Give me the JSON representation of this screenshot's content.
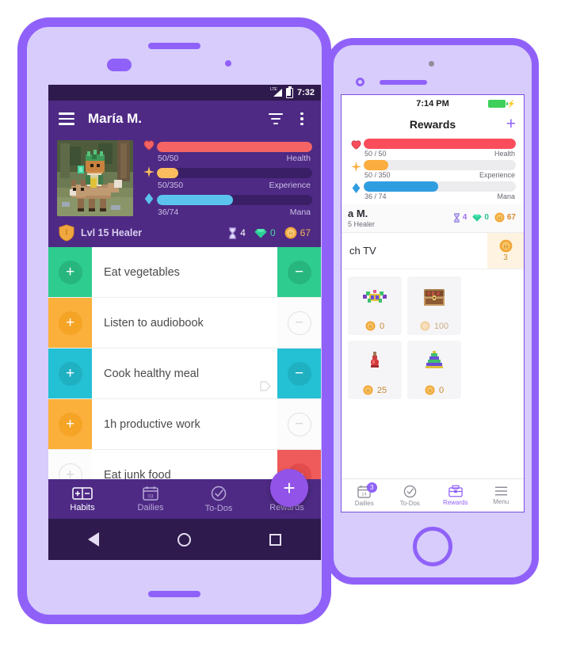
{
  "android": {
    "status_bar": {
      "time": "7:32",
      "signal_label": "LTE"
    },
    "appbar": {
      "title": "María M.",
      "menu_icon": "hamburger-icon",
      "filter_icon": "filter-icon",
      "overflow_icon": "overflow-menu-icon"
    },
    "stats": {
      "bars": [
        {
          "icon": "heart-icon",
          "value": "50/50",
          "label": "Health",
          "percent": 100,
          "color": "#f56465"
        },
        {
          "icon": "star-icon",
          "value": "50/350",
          "label": "Experience",
          "percent": 14,
          "color": "#fbbd5e"
        },
        {
          "icon": "diamond-icon",
          "value": "36/74",
          "label": "Mana",
          "percent": 49,
          "color": "#5cc3ef"
        }
      ],
      "level_text": "Lvl 15 Healer",
      "class_icon": "shield-icon",
      "hourglass_icon": "hourglass-icon",
      "hourglass_value": "4",
      "gem_icon": "gem-icon",
      "gem_value": "0",
      "gold_icon": "gold-coin-icon",
      "gold_value": "67"
    },
    "habits": [
      {
        "title": "Eat vegetables",
        "color": "#2ecc8f",
        "plus": true,
        "minus": true,
        "tag": false
      },
      {
        "title": "Listen to audiobook",
        "color": "#fbb03b",
        "plus": true,
        "minus": false,
        "tag": false
      },
      {
        "title": "Cook healthy meal",
        "color": "#24c0d4",
        "plus": true,
        "minus": true,
        "tag": true
      },
      {
        "title": "1h productive work",
        "color": "#fbb03b",
        "plus": true,
        "minus": false,
        "tag": false
      },
      {
        "title": "Eat junk food",
        "color": "#ef5a5a",
        "plus": false,
        "minus": true,
        "tag": false
      }
    ],
    "fab_label": "+",
    "bottom_nav": [
      {
        "label": "Habits",
        "icon": "habits-icon",
        "active": true
      },
      {
        "label": "Dailies",
        "icon": "calendar-icon",
        "active": false,
        "calendar_day": "03"
      },
      {
        "label": "To-Dos",
        "icon": "check-circle-icon",
        "active": false
      },
      {
        "label": "Rewards",
        "icon": "rewards-chest-icon",
        "active": false
      }
    ],
    "nav_keys": [
      {
        "name": "back-button",
        "icon": "triangle-back-icon"
      },
      {
        "name": "home-button",
        "icon": "circle-home-icon"
      },
      {
        "name": "recents-button",
        "icon": "square-recents-icon"
      }
    ]
  },
  "iphone": {
    "status_bar": {
      "time": "7:14 PM",
      "battery_icon": "battery-full-icon",
      "charging_icon": "lightning-bolt-icon"
    },
    "navbar": {
      "title": "Rewards",
      "add_label": "+"
    },
    "stats": {
      "bars": [
        {
          "icon": "heart-icon",
          "value": "50 / 50",
          "label": "Health",
          "percent": 100,
          "color": "#f94d5c"
        },
        {
          "icon": "star-icon",
          "value": "50 / 350",
          "label": "Experience",
          "percent": 16,
          "color": "#fbad3f"
        },
        {
          "icon": "diamond-icon",
          "value": "36 / 74",
          "label": "Mana",
          "percent": 49,
          "color": "#2f9ee0"
        }
      ],
      "user_name": "a M.",
      "user_class": "5 Healer",
      "hourglass_icon": "hourglass-icon",
      "hourglass_value": "4",
      "gem_icon": "gem-icon",
      "gem_value": "0",
      "gold_icon": "gold-coin-icon",
      "gold_value": "67"
    },
    "reward_row": {
      "title": "ch TV",
      "cost": "3",
      "cost_icon": "gold-coin-icon"
    },
    "reward_grid": [
      {
        "art": "armor-icon",
        "price": "0",
        "dim": false
      },
      {
        "art": "chest-icon",
        "price": "100",
        "dim": true
      },
      {
        "art": "potion-icon",
        "price": "25",
        "dim": false
      },
      {
        "art": "hat-icon",
        "price": "0",
        "dim": false
      }
    ],
    "tabbar": [
      {
        "label": "Dailies",
        "icon": "calendar-icon",
        "active": false,
        "badge": "3",
        "calendar_day": "14"
      },
      {
        "label": "To-Dos",
        "icon": "check-circle-icon",
        "active": false
      },
      {
        "label": "Rewards",
        "icon": "rewards-chest-icon",
        "active": true
      },
      {
        "label": "Menu",
        "icon": "hamburger-icon",
        "active": false
      }
    ]
  },
  "theme": {
    "device_body": "#d7ccfb",
    "device_border": "#9061f9",
    "app_purple": "#4e2a85",
    "status_dark": "#2e1a4d",
    "accent": "#9061f9"
  }
}
